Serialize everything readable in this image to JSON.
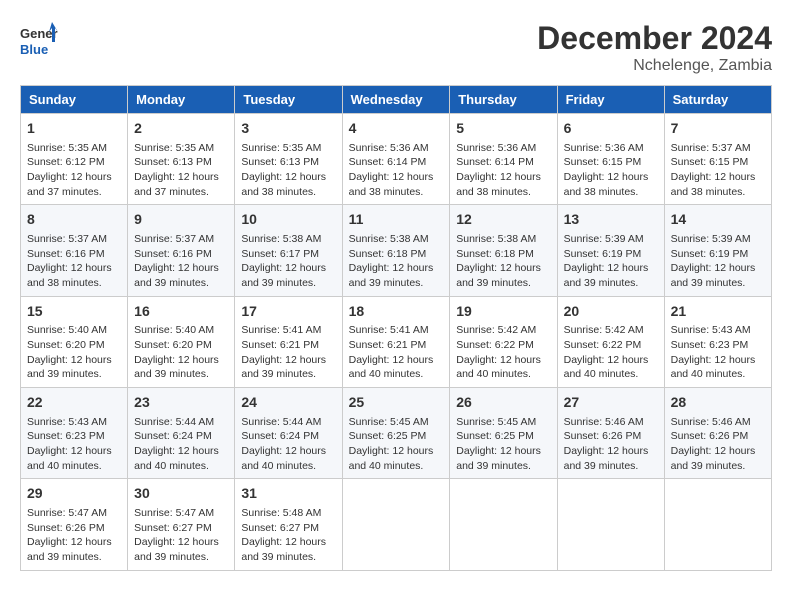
{
  "logo": {
    "text1": "General",
    "text2": "Blue"
  },
  "title": "December 2024",
  "location": "Nchelenge, Zambia",
  "days_of_week": [
    "Sunday",
    "Monday",
    "Tuesday",
    "Wednesday",
    "Thursday",
    "Friday",
    "Saturday"
  ],
  "weeks": [
    [
      {
        "day": "1",
        "sunrise": "5:35 AM",
        "sunset": "6:12 PM",
        "daylight": "12 hours and 37 minutes."
      },
      {
        "day": "2",
        "sunrise": "5:35 AM",
        "sunset": "6:13 PM",
        "daylight": "12 hours and 37 minutes."
      },
      {
        "day": "3",
        "sunrise": "5:35 AM",
        "sunset": "6:13 PM",
        "daylight": "12 hours and 38 minutes."
      },
      {
        "day": "4",
        "sunrise": "5:36 AM",
        "sunset": "6:14 PM",
        "daylight": "12 hours and 38 minutes."
      },
      {
        "day": "5",
        "sunrise": "5:36 AM",
        "sunset": "6:14 PM",
        "daylight": "12 hours and 38 minutes."
      },
      {
        "day": "6",
        "sunrise": "5:36 AM",
        "sunset": "6:15 PM",
        "daylight": "12 hours and 38 minutes."
      },
      {
        "day": "7",
        "sunrise": "5:37 AM",
        "sunset": "6:15 PM",
        "daylight": "12 hours and 38 minutes."
      }
    ],
    [
      {
        "day": "8",
        "sunrise": "5:37 AM",
        "sunset": "6:16 PM",
        "daylight": "12 hours and 38 minutes."
      },
      {
        "day": "9",
        "sunrise": "5:37 AM",
        "sunset": "6:16 PM",
        "daylight": "12 hours and 39 minutes."
      },
      {
        "day": "10",
        "sunrise": "5:38 AM",
        "sunset": "6:17 PM",
        "daylight": "12 hours and 39 minutes."
      },
      {
        "day": "11",
        "sunrise": "5:38 AM",
        "sunset": "6:18 PM",
        "daylight": "12 hours and 39 minutes."
      },
      {
        "day": "12",
        "sunrise": "5:38 AM",
        "sunset": "6:18 PM",
        "daylight": "12 hours and 39 minutes."
      },
      {
        "day": "13",
        "sunrise": "5:39 AM",
        "sunset": "6:19 PM",
        "daylight": "12 hours and 39 minutes."
      },
      {
        "day": "14",
        "sunrise": "5:39 AM",
        "sunset": "6:19 PM",
        "daylight": "12 hours and 39 minutes."
      }
    ],
    [
      {
        "day": "15",
        "sunrise": "5:40 AM",
        "sunset": "6:20 PM",
        "daylight": "12 hours and 39 minutes."
      },
      {
        "day": "16",
        "sunrise": "5:40 AM",
        "sunset": "6:20 PM",
        "daylight": "12 hours and 39 minutes."
      },
      {
        "day": "17",
        "sunrise": "5:41 AM",
        "sunset": "6:21 PM",
        "daylight": "12 hours and 39 minutes."
      },
      {
        "day": "18",
        "sunrise": "5:41 AM",
        "sunset": "6:21 PM",
        "daylight": "12 hours and 40 minutes."
      },
      {
        "day": "19",
        "sunrise": "5:42 AM",
        "sunset": "6:22 PM",
        "daylight": "12 hours and 40 minutes."
      },
      {
        "day": "20",
        "sunrise": "5:42 AM",
        "sunset": "6:22 PM",
        "daylight": "12 hours and 40 minutes."
      },
      {
        "day": "21",
        "sunrise": "5:43 AM",
        "sunset": "6:23 PM",
        "daylight": "12 hours and 40 minutes."
      }
    ],
    [
      {
        "day": "22",
        "sunrise": "5:43 AM",
        "sunset": "6:23 PM",
        "daylight": "12 hours and 40 minutes."
      },
      {
        "day": "23",
        "sunrise": "5:44 AM",
        "sunset": "6:24 PM",
        "daylight": "12 hours and 40 minutes."
      },
      {
        "day": "24",
        "sunrise": "5:44 AM",
        "sunset": "6:24 PM",
        "daylight": "12 hours and 40 minutes."
      },
      {
        "day": "25",
        "sunrise": "5:45 AM",
        "sunset": "6:25 PM",
        "daylight": "12 hours and 40 minutes."
      },
      {
        "day": "26",
        "sunrise": "5:45 AM",
        "sunset": "6:25 PM",
        "daylight": "12 hours and 39 minutes."
      },
      {
        "day": "27",
        "sunrise": "5:46 AM",
        "sunset": "6:26 PM",
        "daylight": "12 hours and 39 minutes."
      },
      {
        "day": "28",
        "sunrise": "5:46 AM",
        "sunset": "6:26 PM",
        "daylight": "12 hours and 39 minutes."
      }
    ],
    [
      {
        "day": "29",
        "sunrise": "5:47 AM",
        "sunset": "6:26 PM",
        "daylight": "12 hours and 39 minutes."
      },
      {
        "day": "30",
        "sunrise": "5:47 AM",
        "sunset": "6:27 PM",
        "daylight": "12 hours and 39 minutes."
      },
      {
        "day": "31",
        "sunrise": "5:48 AM",
        "sunset": "6:27 PM",
        "daylight": "12 hours and 39 minutes."
      },
      null,
      null,
      null,
      null
    ]
  ]
}
